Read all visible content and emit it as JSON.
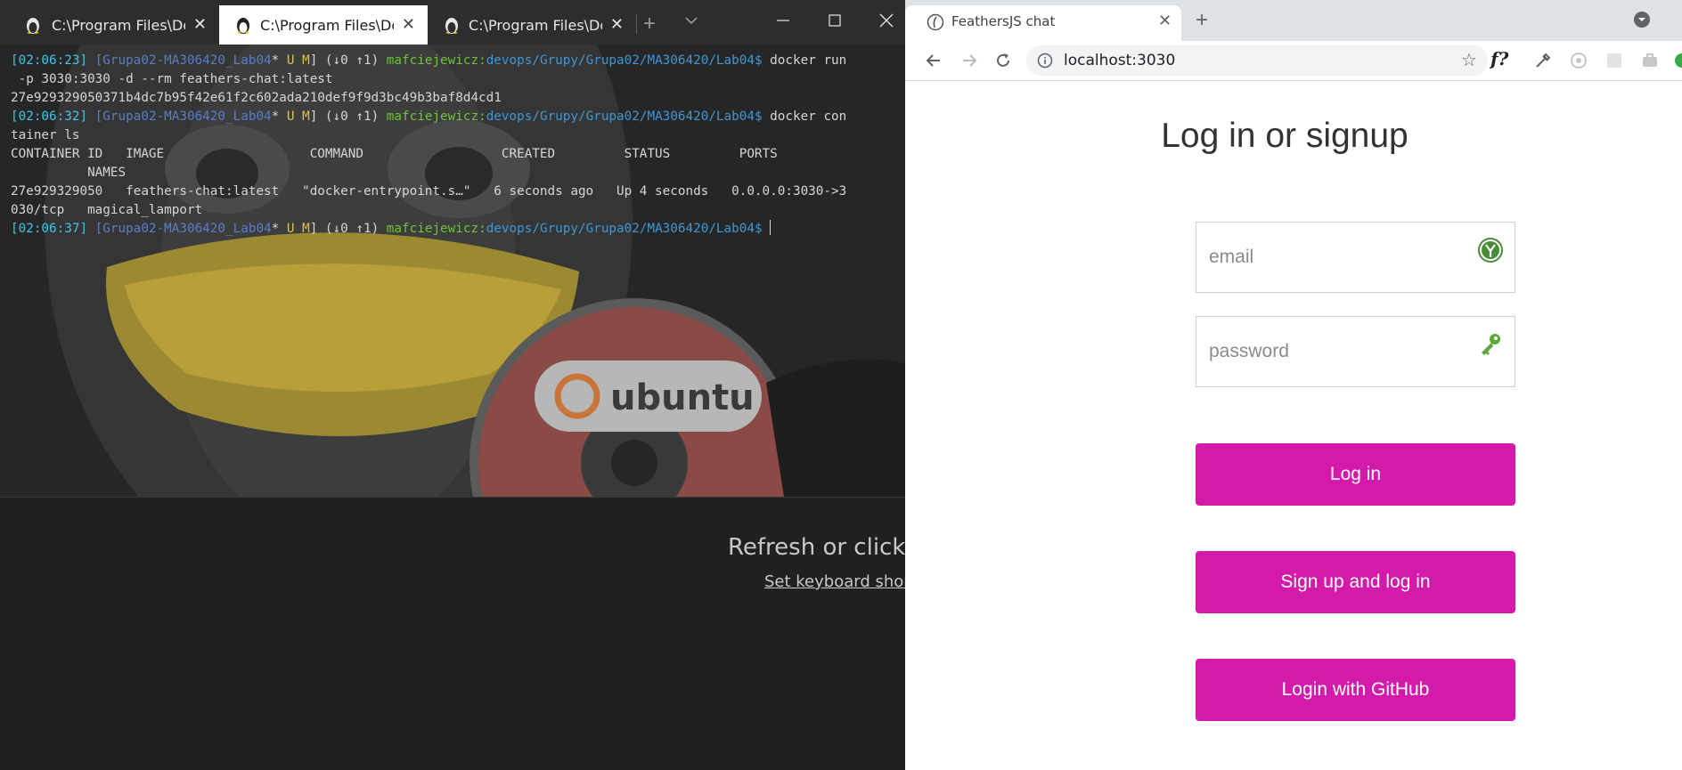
{
  "desktop": {
    "refresh_text": "Refresh or click to",
    "shortcut_link": "Set keyboard shortc"
  },
  "terminal": {
    "tabs": [
      {
        "label": "C:\\Program Files\\Docl"
      },
      {
        "label": "C:\\Program Files\\Docl"
      },
      {
        "label": "C:\\Program Files\\Docl"
      }
    ],
    "prompt": {
      "branch": "[Grupa02-MA306420_Lab04",
      "star": "* ",
      "um": "U M",
      "sync": "] (↓0 ↑1) ",
      "user": "mafciejewicz:",
      "path": "devops/Grupy/Grupa02/MA306420/Lab04$"
    },
    "lines": {
      "t1": "[02:06:23]",
      "cmd1": " docker run",
      "cmd1b": " -p 3030:3030 -d --rm feathers-chat:latest",
      "out1": "27e929329050371b4dc7b95f42e61f2c602ada210def9f9d3bc49b3baf8d4cd1",
      "t2": "[02:06:32]",
      "cmd2": " docker con",
      "cmd2b": "tainer ls",
      "hdr1": "CONTAINER ID   IMAGE                   COMMAND                  CREATED         STATUS         PORTS",
      "hdr2": "          NAMES",
      "row1": "27e929329050   feathers-chat:latest   \"docker-entrypoint.s…\"   6 seconds ago   Up 4 seconds   0.0.0.0:3030->3",
      "row2": "030/tcp   magical_lamport",
      "t3": "[02:06:37]"
    },
    "wallpaper_text": "ubuntu"
  },
  "browser": {
    "tab_title": "FeathersJS chat",
    "url": "localhost:3030",
    "ext_f": "f?"
  },
  "page": {
    "title": "Log in or signup",
    "email_placeholder": "email",
    "password_placeholder": "password",
    "login_label": "Log in",
    "signup_label": "Sign up and log in",
    "github_label": "Login with GitHub"
  },
  "colors": {
    "primary_button": "#d41aaa",
    "terminal_time": "#3fc6e8",
    "terminal_user": "#6dc33a",
    "terminal_path": "#3f97d6"
  }
}
